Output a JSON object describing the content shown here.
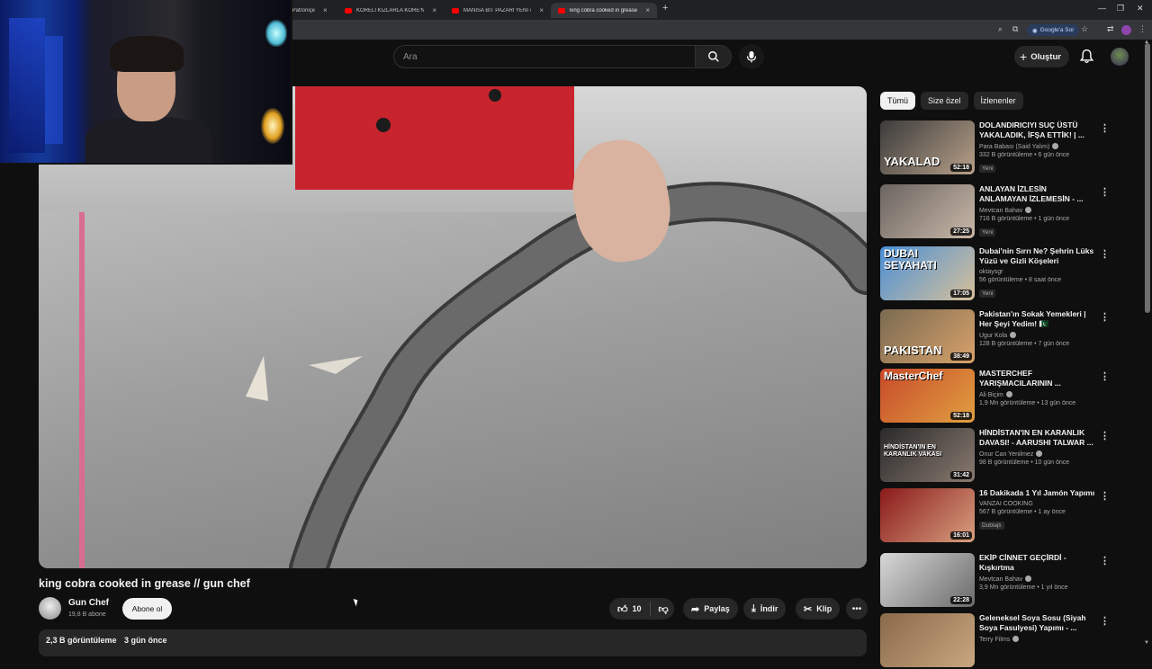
{
  "browser": {
    "tabs": [
      {
        "label": "v Patroniçe",
        "active": false
      },
      {
        "label": "KORELİ KIZLARLA KORE'NİN EN",
        "active": false
      },
      {
        "label": "MANİSA BİT PAZARI YENİ #23",
        "active": false
      },
      {
        "label": "king cobra cooked in grease //",
        "active": true
      }
    ],
    "google_sor_label": "Google'a Sor"
  },
  "header": {
    "search_placeholder": "Ara",
    "create_label": "Oluştur"
  },
  "video": {
    "title": "king cobra cooked in grease // gun chef",
    "channel_name": "Gun Chef",
    "subscribers": "19,8 B abone",
    "subscribe_label": "Abone ol",
    "like_count": "10",
    "share_label": "Paylaş",
    "download_label": "İndir",
    "clip_label": "Klip",
    "views": "2,3 B görüntüleme",
    "posted": "3 gün önce"
  },
  "chips": [
    {
      "label": "Tümü",
      "active": true
    },
    {
      "label": "Size özel",
      "active": false
    },
    {
      "label": "İzlenenler",
      "active": false
    }
  ],
  "recommendations": [
    {
      "title": "DOLANDIRICIYI SUÇ ÜSTÜ YAKALADIK, İFŞA ETTİK! | ...",
      "channel": "Para Babası (Said Yalım)",
      "verified": true,
      "views": "332 B görüntüleme",
      "age": "6 gün önce",
      "badge": "Yeni",
      "duration": "52:18",
      "thumb_text": "YAKALAD",
      "thumb_colors": [
        "#3b3b3b",
        "#b8a089"
      ]
    },
    {
      "title": "ANLAYAN İZLESİN ANLAMAYAN İZLEMESİN - ...",
      "channel": "Mevtcan Bahav",
      "verified": true,
      "views": "716 B görüntüleme",
      "age": "1 gün önce",
      "badge": "Yeni",
      "duration": "27:25",
      "thumb_text": "",
      "thumb_colors": [
        "#6b6460",
        "#c9b8a8"
      ]
    },
    {
      "title": "Dubai'nin Sırrı Ne? Şehrin Lüks Yüzü ve Gizli Köşeleri",
      "channel": "oktaysgr",
      "verified": false,
      "views": "56 görüntüleme",
      "age": "8 saat önce",
      "badge": "Yeni",
      "duration": "17:05",
      "thumb_text": "DUBAI SEYAHATI",
      "thumb_colors": [
        "#4a8fd6",
        "#d8c09a"
      ]
    },
    {
      "title": "Pakistan'ın Sokak Yemekleri | Her Şeyi Yedim! 🇵🇰",
      "channel": "Ugur Kola",
      "verified": true,
      "views": "128 B görüntüleme",
      "age": "7 gün önce",
      "badge": "",
      "duration": "38:49",
      "thumb_text": "PAKISTAN",
      "thumb_colors": [
        "#7a6a52",
        "#d8a26a"
      ]
    },
    {
      "title": "MASTERCHEF YARIŞMACILARININ ...",
      "channel": "Ali Biçim",
      "verified": true,
      "views": "1,9 Mn görüntüleme",
      "age": "13 gün önce",
      "badge": "",
      "duration": "52:18",
      "thumb_text": "MasterChef",
      "thumb_colors": [
        "#c84a2a",
        "#e0a040"
      ]
    },
    {
      "title": "HİNDİSTAN'IN EN KARANLIK DAVASI! - AARUSHI TALWAR ...",
      "channel": "Onur Can Yenilmez",
      "verified": true,
      "views": "98 B görüntüleme",
      "age": "10 gün önce",
      "badge": "",
      "duration": "31:42",
      "thumb_text": "HİNDİSTAN'IN EN KARANLIK VAKASI",
      "thumb_colors": [
        "#2a2a2a",
        "#8a7a70"
      ]
    },
    {
      "title": "16 Dakikada 1 Yıl Jamón Yapımı",
      "channel": "VANZAI COOKING",
      "verified": false,
      "views": "567 B görüntüleme",
      "age": "1 ay önce",
      "badge": "Dublajlı",
      "duration": "16:01",
      "thumb_text": "",
      "thumb_colors": [
        "#8a1a1a",
        "#d8a080"
      ]
    },
    {
      "title": "EKİP CİNNET GEÇİRDİ - Kışkırtma",
      "channel": "Mevtcan Bahav",
      "verified": true,
      "views": "3,9 Mn görüntüleme",
      "age": "1 yıl önce",
      "badge": "",
      "duration": "22:28",
      "thumb_text": "",
      "thumb_colors": [
        "#d8d8d8",
        "#6a6a6a"
      ]
    },
    {
      "title": "Geleneksel Soya Sosu (Siyah Soya Fasulyesi) Yapımı - ...",
      "channel": "Terry Films",
      "verified": true,
      "views": "",
      "age": "",
      "badge": "",
      "duration": "",
      "thumb_text": "",
      "thumb_colors": [
        "#8a6a4a",
        "#c8a880"
      ]
    }
  ]
}
